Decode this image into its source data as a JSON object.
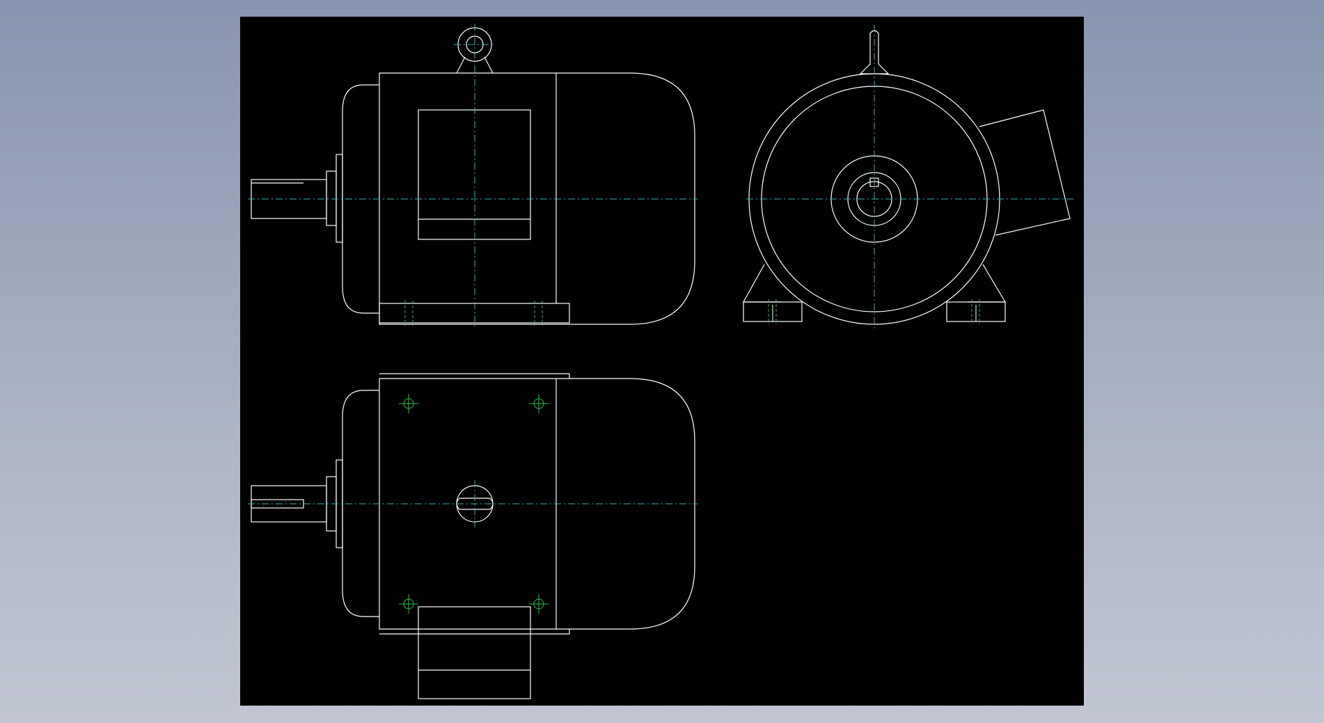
{
  "viewport": {
    "background": "gradient",
    "drawing_sheet_color": "#000000"
  },
  "colors": {
    "outline": "#ffffff",
    "centerline": "#2fb8b8",
    "hole_marks": "#29c24a"
  },
  "views": [
    {
      "id": "front-view",
      "label": ""
    },
    {
      "id": "side-view",
      "label": ""
    },
    {
      "id": "top-view",
      "label": ""
    }
  ]
}
